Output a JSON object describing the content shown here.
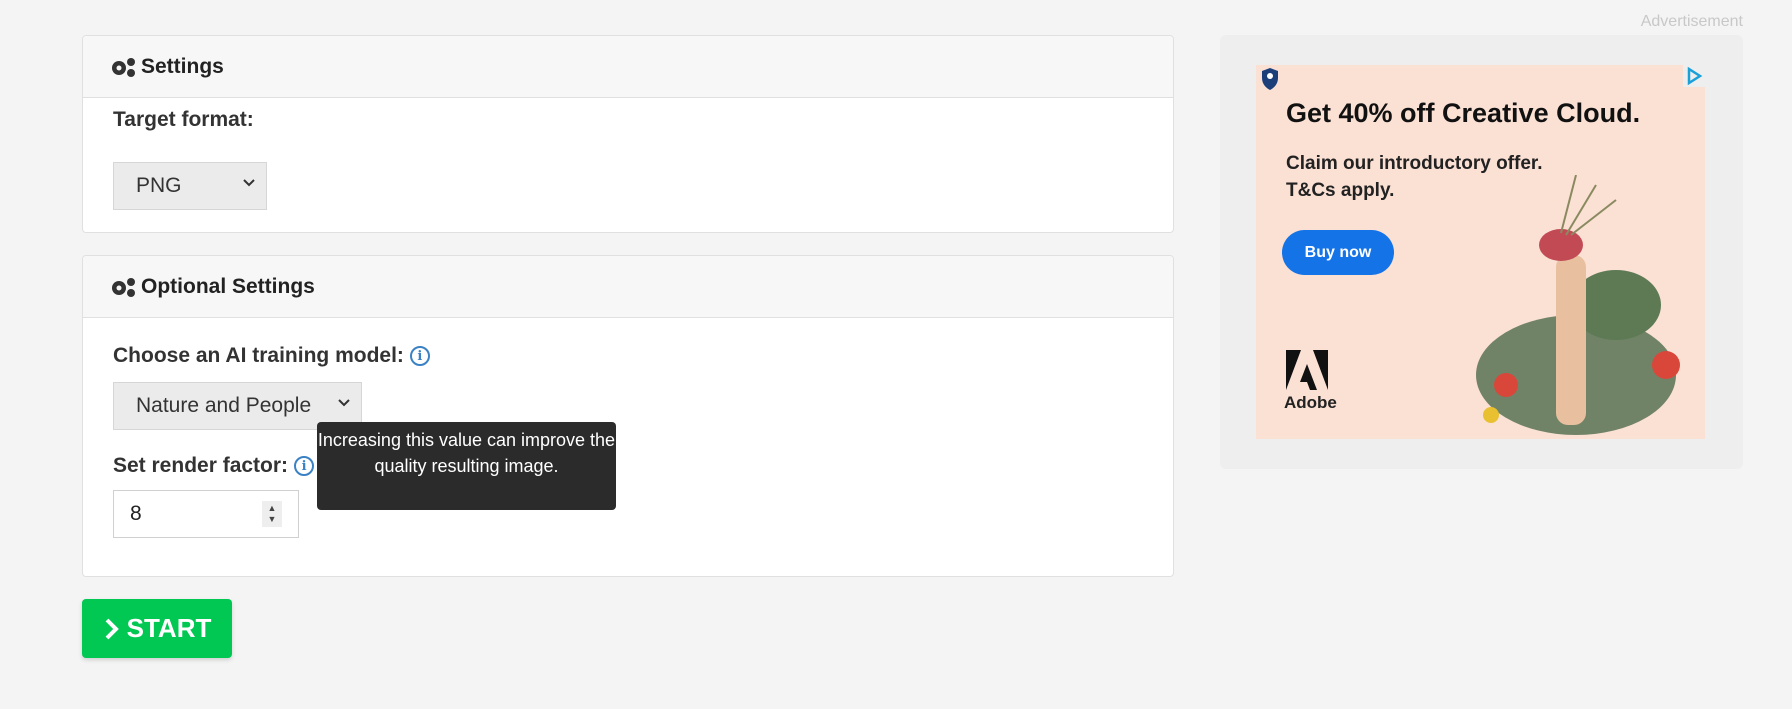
{
  "settings": {
    "title": "Settings",
    "target_format_label": "Target format:",
    "target_format_value": "PNG"
  },
  "optional": {
    "title": "Optional Settings",
    "model_label": "Choose an AI training model:",
    "model_value": "Nature and People",
    "render_label": "Set render factor:",
    "render_value": "8",
    "tooltip": "Increasing this value can improve the quality resulting image."
  },
  "start_label": "START",
  "ad": {
    "label": "Advertisement",
    "headline": "Get 40% off Creative Cloud.",
    "line1": "Claim our introductory offer.",
    "line2": "T&Cs apply.",
    "button": "Buy now",
    "brand": "Adobe"
  },
  "colors": {
    "start": "#00c853",
    "info": "#3b82c4",
    "ad_button": "#1473e6"
  }
}
